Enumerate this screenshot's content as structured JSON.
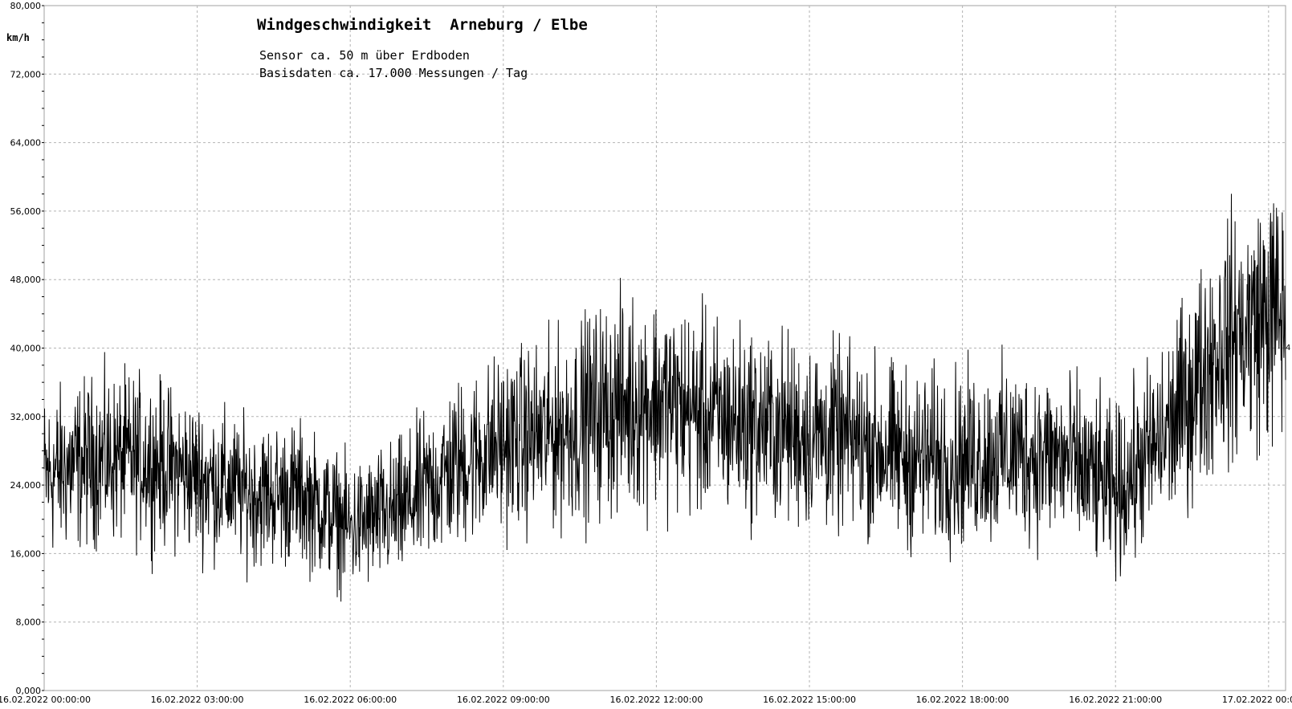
{
  "chart_data": {
    "type": "line",
    "title": "Windgeschwindigkeit  Arneburg / Elbe",
    "subtitle_lines": [
      "Sensor ca. 50 m über Erdboden",
      "Basisdaten ca. 17.000 Messungen / Tag"
    ],
    "ylabel": "km/h",
    "ylim": [
      0,
      80
    ],
    "yticks": [
      0,
      8,
      16,
      24,
      32,
      40,
      48,
      56,
      64,
      72,
      80
    ],
    "ytick_labels": [
      "0,000",
      "8,000",
      "16,000",
      "24,000",
      "32,000",
      "40,000",
      "48,000",
      "56,000",
      "64,000",
      "72,000",
      "80,000"
    ],
    "xlim": [
      "2022-02-16 00:00",
      "2022-02-17 00:20"
    ],
    "xticks": [
      "2022-02-16 00:00",
      "2022-02-16 03:00",
      "2022-02-16 06:00",
      "2022-02-16 09:00",
      "2022-02-16 12:00",
      "2022-02-16 15:00",
      "2022-02-16 18:00",
      "2022-02-16 21:00",
      "2022-02-17 00:00"
    ],
    "xtick_labels": [
      "16.02.2022  00:00:00",
      "16.02.2022  03:00:00",
      "16.02.2022  06:00:00",
      "16.02.2022  09:00:00",
      "16.02.2022  12:00:00",
      "16.02.2022  15:00:00",
      "16.02.2022  18:00:00",
      "16.02.2022  21:00:00",
      "17.02.2022  00:00:00"
    ],
    "grid": true,
    "right_edge_label": "4",
    "series": [
      {
        "color": "#000000",
        "trend_x": [
          "2022-02-16 00:00",
          "2022-02-16 01:00",
          "2022-02-16 02:00",
          "2022-02-16 03:00",
          "2022-02-16 04:00",
          "2022-02-16 05:00",
          "2022-02-16 06:00",
          "2022-02-16 07:00",
          "2022-02-16 08:00",
          "2022-02-16 09:00",
          "2022-02-16 10:00",
          "2022-02-16 11:00",
          "2022-02-16 12:00",
          "2022-02-16 13:00",
          "2022-02-16 14:00",
          "2022-02-16 15:00",
          "2022-02-16 16:00",
          "2022-02-16 17:00",
          "2022-02-16 18:00",
          "2022-02-16 19:00",
          "2022-02-16 20:00",
          "2022-02-16 21:00",
          "2022-02-16 22:00",
          "2022-02-16 23:00",
          "2022-02-17 00:00"
        ],
        "trend_mean": [
          25,
          27,
          27,
          25,
          23,
          23,
          19,
          21,
          26,
          29,
          30,
          33,
          34,
          32,
          31,
          30,
          29,
          27,
          27,
          28,
          27,
          23,
          30,
          40,
          44
        ],
        "trend_spread": [
          14,
          14,
          14,
          13,
          12,
          12,
          11,
          12,
          14,
          15,
          16,
          18,
          18,
          17,
          16,
          16,
          15,
          15,
          15,
          15,
          15,
          14,
          16,
          20,
          22
        ]
      }
    ]
  }
}
